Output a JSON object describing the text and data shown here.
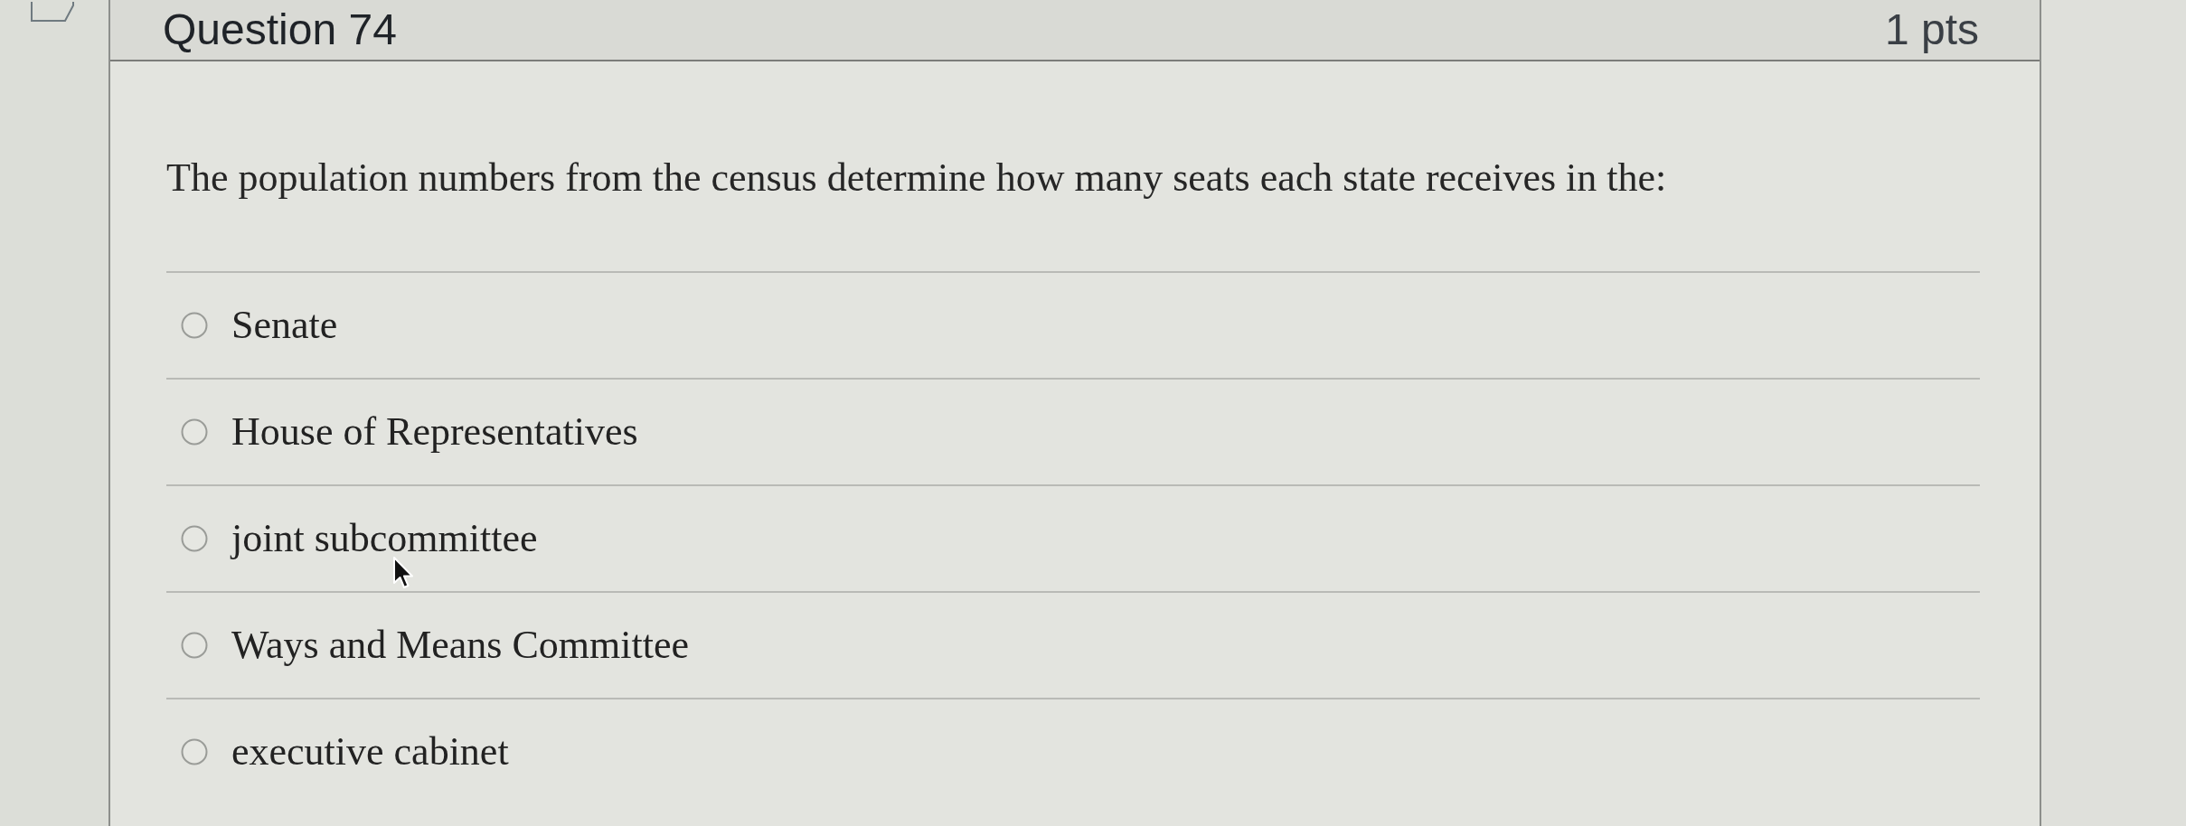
{
  "question": {
    "title": "Question 74",
    "points": "1 pts",
    "prompt": "The population numbers from the census determine how many seats each state receives in the:",
    "options": [
      {
        "label": "Senate",
        "selected": false
      },
      {
        "label": "House of Representatives",
        "selected": false
      },
      {
        "label": "joint subcommittee",
        "selected": false
      },
      {
        "label": "Ways and Means Committee",
        "selected": false
      },
      {
        "label": "executive cabinet",
        "selected": false
      }
    ]
  }
}
